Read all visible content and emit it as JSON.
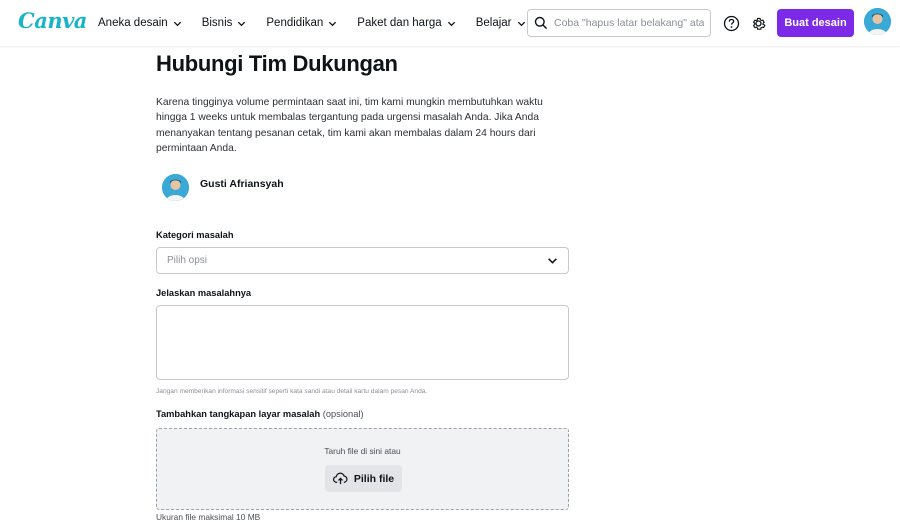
{
  "header": {
    "logo": "Canva",
    "nav": [
      {
        "label": "Aneka desain"
      },
      {
        "label": "Bisnis"
      },
      {
        "label": "Pendidikan"
      },
      {
        "label": "Paket dan harga"
      },
      {
        "label": "Belajar"
      }
    ],
    "search_placeholder": "Coba \"hapus latar belakang\" atau \"slide\"",
    "create_button": "Buat desain",
    "icons": {
      "search": "search-icon",
      "help": "help-icon",
      "settings": "gear-icon",
      "avatar": "user-avatar"
    }
  },
  "main": {
    "title": "Hubungi Tim Dukungan",
    "intro": "Karena tingginya volume permintaan saat ini, tim kami mungkin membutuhkan waktu hingga 1 weeks untuk membalas tergantung pada urgensi masalah Anda. Jika Anda menanyakan tentang pesanan cetak, tim kami akan membalas dalam 24 hours dari permintaan Anda.",
    "user_name": "Gusti Afriansyah",
    "category_label": "Kategori masalah",
    "category_placeholder": "Pilih opsi",
    "describe_label": "Jelaskan masalahnya",
    "describe_hint": "Jangan memberikan informasi sensitif seperti kata sandi atau detail kartu dalam pesan Anda.",
    "screenshot_label": "Tambahkan tangkapan layar masalah",
    "screenshot_optional": "(opsional)",
    "drop_text": "Taruh file di sini atau",
    "choose_file": "Pilih file",
    "max_size": "Ukuran file maksimal 10 MB"
  },
  "colors": {
    "brand": "#7d2ae8",
    "logo": "#19b4c8"
  }
}
